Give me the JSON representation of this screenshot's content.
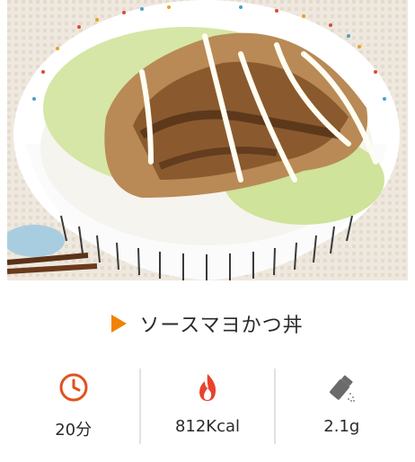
{
  "recipe": {
    "title": "ソースマヨかつ丼"
  },
  "stats": [
    {
      "icon": "clock-icon",
      "value": "20分"
    },
    {
      "icon": "flame-icon",
      "value": "812Kcal"
    },
    {
      "icon": "salt-shaker-icon",
      "value": "2.1g"
    }
  ],
  "colors": {
    "accent": "#f08300",
    "clock": "#e0521f",
    "flame": "#e8432c",
    "shaker": "#6b6b6b"
  }
}
